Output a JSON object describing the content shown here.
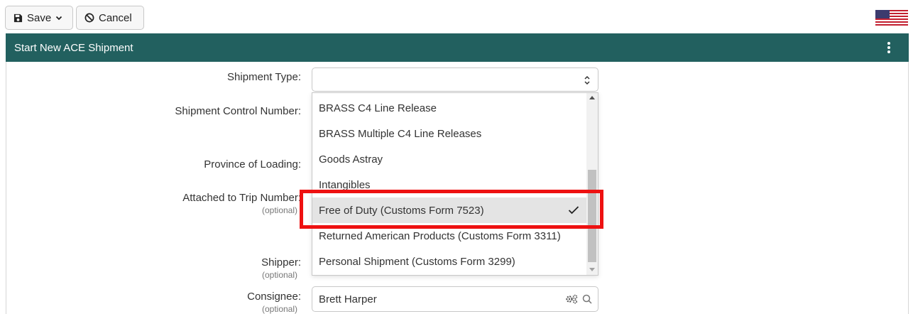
{
  "toolbar": {
    "save_label": "Save",
    "cancel_label": "Cancel"
  },
  "panel": {
    "title": "Start New ACE Shipment"
  },
  "form": {
    "shipment_type_label": "Shipment Type:",
    "shipment_type_value": "",
    "shipment_control_label": "Shipment Control Number:",
    "province_label": "Province of Loading:",
    "attached_trip_label": "Attached to Trip Number:",
    "attached_trip_optional": "(optional)",
    "shipper_label": "Shipper:",
    "shipper_optional": "(optional)",
    "consignee_label": "Consignee:",
    "consignee_optional": "(optional)",
    "consignee_value": "Brett Harper"
  },
  "dropdown": {
    "items": [
      {
        "label": "BRASS C4 Line Release"
      },
      {
        "label": "BRASS Multiple C4 Line Releases"
      },
      {
        "label": "Goods Astray"
      },
      {
        "label": "Intangibles"
      },
      {
        "label": "Free of Duty (Customs Form 7523)",
        "selected": true
      },
      {
        "label": "Returned American Products (Customs Form 3311)"
      },
      {
        "label": "Personal Shipment (Customs Form 3299)"
      }
    ]
  },
  "colors": {
    "header_bg": "#22605f",
    "highlight": "#ee1111"
  },
  "icons": {
    "save": "floppy-disk-icon",
    "cancel": "ban-icon",
    "menu": "vertical-ellipsis-icon",
    "flag": "us-flag-icon",
    "consignee_settings": "gears-icon",
    "consignee_search": "search-icon"
  }
}
